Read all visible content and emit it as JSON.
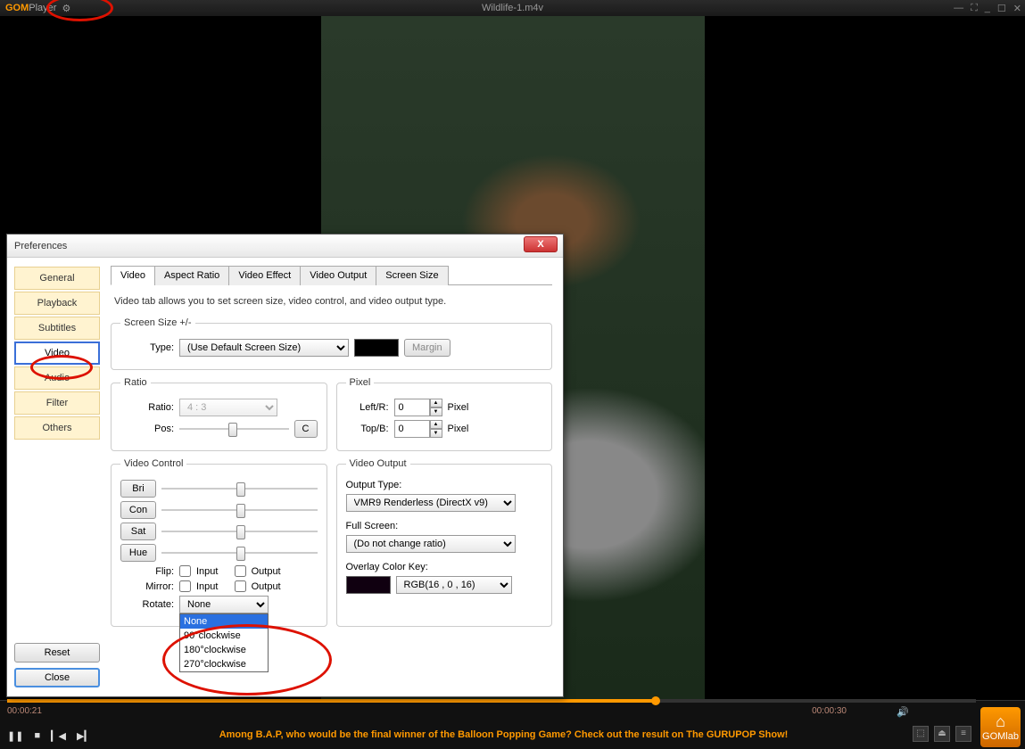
{
  "app": {
    "logo1": "GOM",
    "logo2": "Player",
    "title": "Wildlife-1.m4v"
  },
  "player": {
    "time_current": "00:00:21",
    "time_total": "00:00:30",
    "marquee": "Among B.A.P, who would be the final winner of the Balloon Popping Game? Check out the result on The GURUPOP Show!",
    "home_label": "GOMlab"
  },
  "prefs": {
    "title": "Preferences",
    "cats": [
      "General",
      "Playback",
      "Subtitles",
      "Video",
      "Audio",
      "Filter",
      "Others"
    ],
    "selected_cat": "Video",
    "reset": "Reset",
    "close": "Close",
    "tabs": [
      "Video",
      "Aspect Ratio",
      "Video Effect",
      "Video Output",
      "Screen Size"
    ],
    "active_tab": "Video",
    "desc": "Video tab allows you to set screen size, video control, and video output type.",
    "screen_size": {
      "legend": "Screen Size +/-",
      "type_label": "Type:",
      "type_value": "(Use Default Screen Size)",
      "margin": "Margin"
    },
    "ratio": {
      "legend": "Ratio",
      "ratio_label": "Ratio:",
      "ratio_value": "4 : 3",
      "pos_label": "Pos:",
      "c_btn": "C"
    },
    "pixel": {
      "legend": "Pixel",
      "left_label": "Left/R:",
      "top_label": "Top/B:",
      "unit": "Pixel",
      "left_val": "0",
      "top_val": "0"
    },
    "vcontrol": {
      "legend": "Video Control",
      "bri": "Bri",
      "con": "Con",
      "sat": "Sat",
      "hue": "Hue",
      "flip": "Flip:",
      "mirror": "Mirror:",
      "rotate": "Rotate:",
      "input": "Input",
      "output": "Output",
      "rotate_sel": "None",
      "rotate_opts": [
        "None",
        "90°clockwise",
        "180°clockwise",
        "270°clockwise"
      ]
    },
    "vout": {
      "legend": "Video Output",
      "out_type": "Output Type:",
      "out_val": "VMR9 Renderless (DirectX v9)",
      "fs": "Full Screen:",
      "fs_val": "(Do not change ratio)",
      "overlay": "Overlay Color Key:",
      "overlay_val": "RGB(16 , 0 , 16)"
    }
  }
}
